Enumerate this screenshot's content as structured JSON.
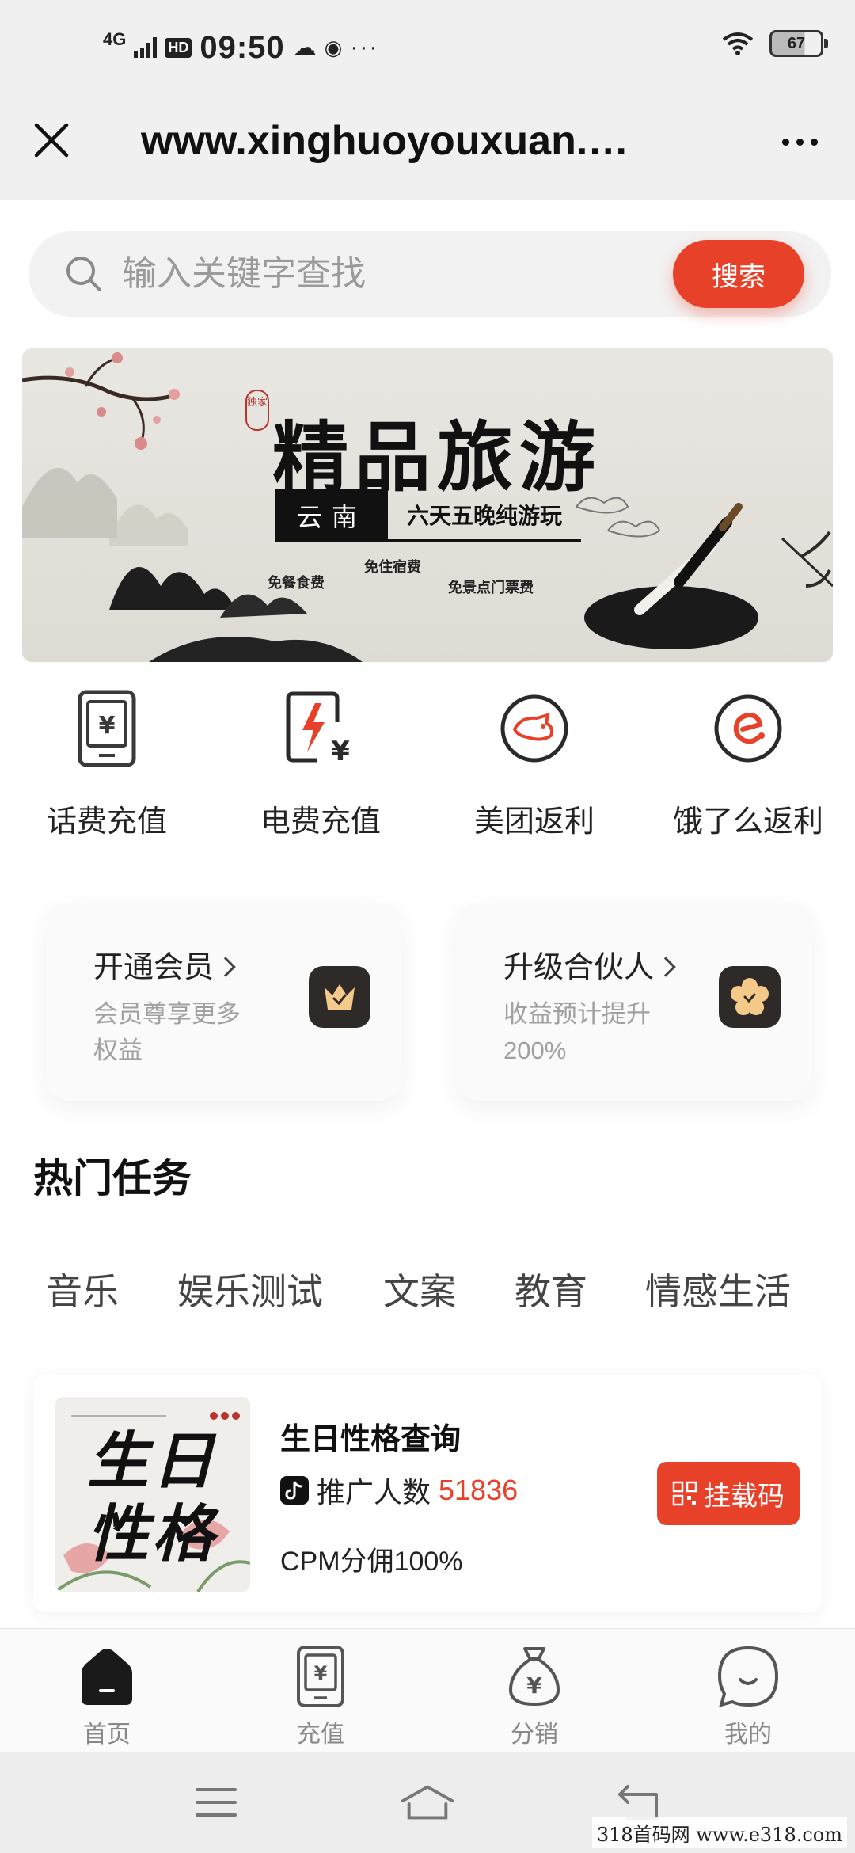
{
  "status_bar": {
    "network": "4G",
    "hd": "HD",
    "time": "09:50",
    "battery": "67"
  },
  "browser": {
    "url_title": "www.xinghuoyouxuan.…"
  },
  "search": {
    "placeholder": "输入关键字查找",
    "button_label": "搜索"
  },
  "banner": {
    "stamp": "独家",
    "title": "精品旅游",
    "place": "云南",
    "subtitle": "六天五晚纯游玩",
    "perks": [
      "免餐食费",
      "免住宿费",
      "免景点门票费"
    ]
  },
  "quick_entries": [
    {
      "label": "话费充值",
      "icon": "phone-bill-icon"
    },
    {
      "label": "电费充值",
      "icon": "electric-bill-icon"
    },
    {
      "label": "美团返利",
      "icon": "meituan-icon"
    },
    {
      "label": "饿了么返利",
      "icon": "eleme-icon"
    }
  ],
  "promos": [
    {
      "title": "开通会员",
      "desc": "会员尊享更多权益",
      "icon": "crown-badge-icon"
    },
    {
      "title": "升级合伙人",
      "desc": "收益预计提升200%",
      "icon": "flower-badge-icon"
    }
  ],
  "hot_tasks": {
    "title": "热门任务",
    "tabs": [
      "音乐",
      "娱乐测试",
      "文案",
      "教育",
      "情感生活"
    ]
  },
  "task": {
    "thumb_text_line1": "生日",
    "thumb_text_line2": "性格",
    "title": "生日性格查询",
    "promo_label": "推广人数",
    "promo_count": "51836",
    "cpm": "CPM分佣100%",
    "button_label": "挂载码"
  },
  "bottom_nav": [
    {
      "label": "首页",
      "icon": "home-icon",
      "active": true
    },
    {
      "label": "充值",
      "icon": "recharge-icon",
      "active": false
    },
    {
      "label": "分销",
      "icon": "money-bag-icon",
      "active": false
    },
    {
      "label": "我的",
      "icon": "profile-icon",
      "active": false
    }
  ],
  "watermark": "318首码网 www.e318.com",
  "colors": {
    "accent": "#e8412a",
    "background": "#ffffff",
    "bar_gray": "#f0f0f0"
  }
}
